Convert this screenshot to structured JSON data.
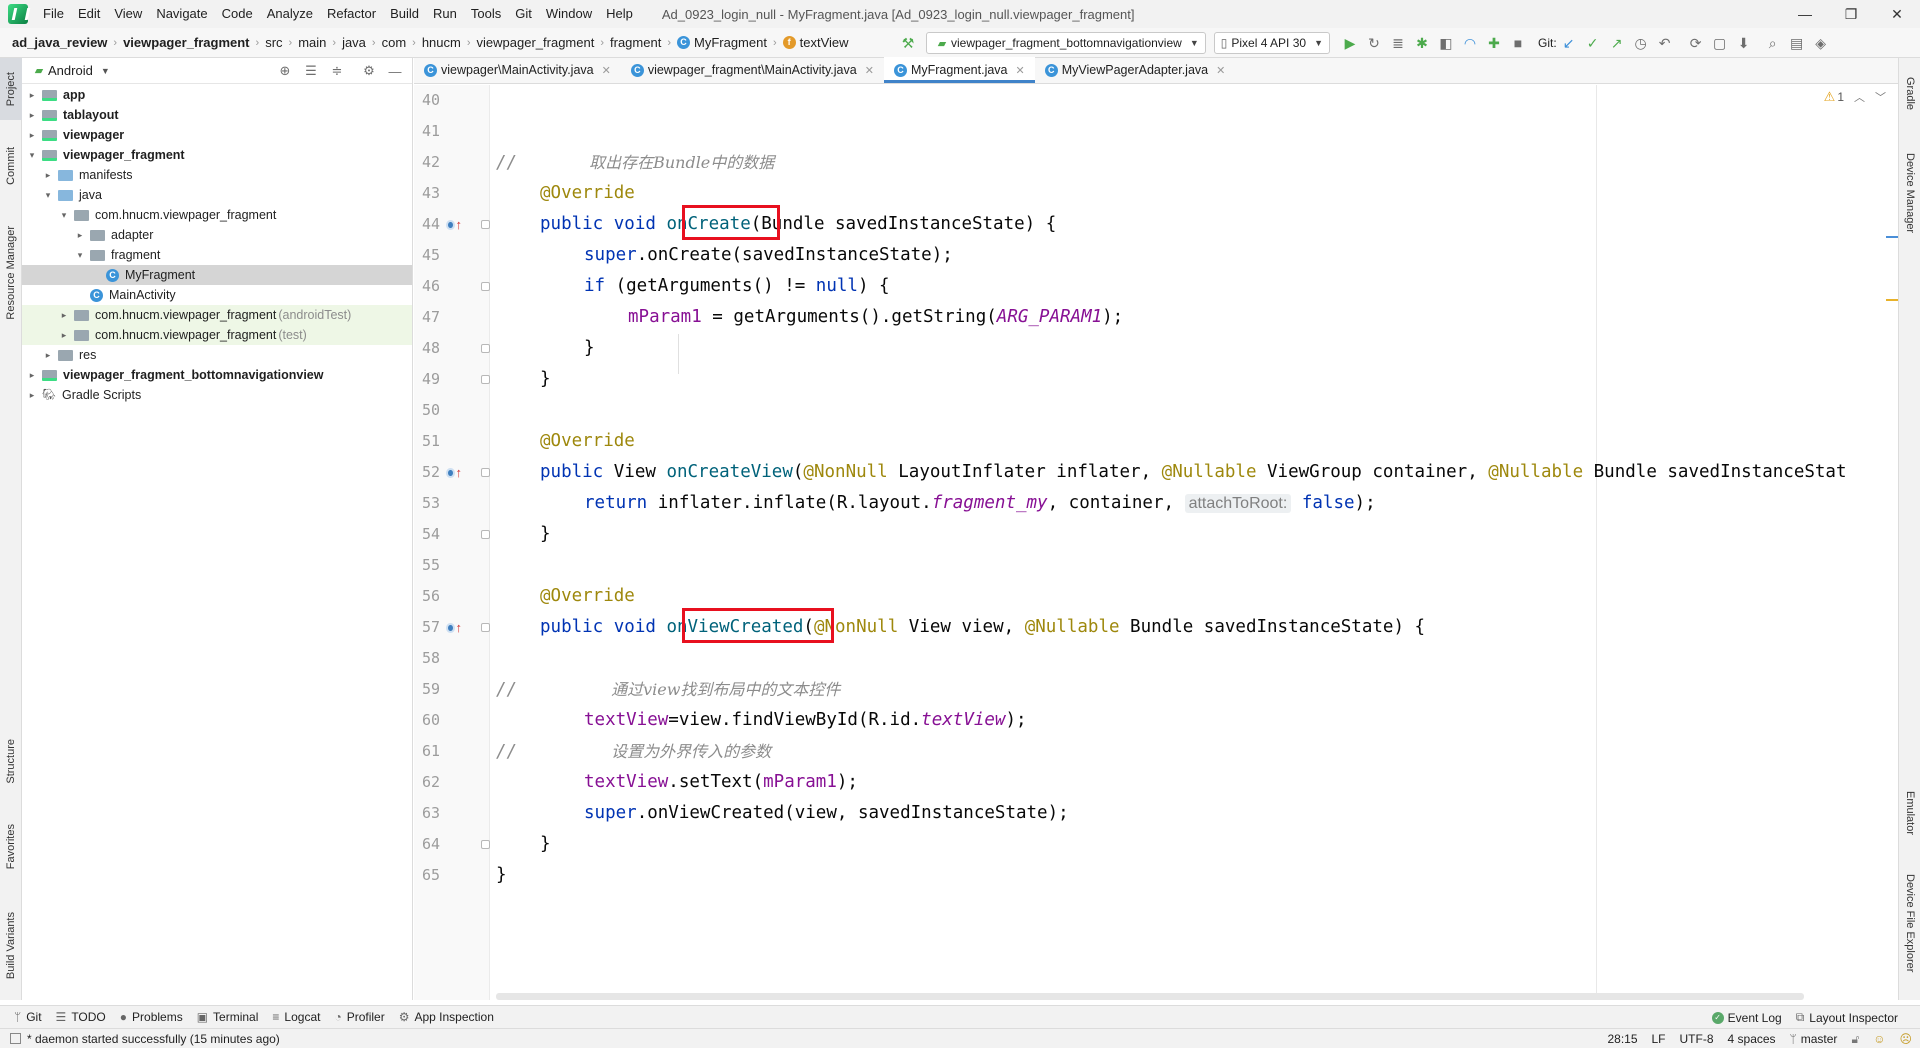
{
  "menubar": {
    "items": [
      "File",
      "Edit",
      "View",
      "Navigate",
      "Code",
      "Analyze",
      "Refactor",
      "Build",
      "Run",
      "Tools",
      "Git",
      "Window",
      "Help"
    ],
    "window_title": "Ad_0923_login_null - MyFragment.java [Ad_0923_login_null.viewpager_fragment]"
  },
  "navbar": {
    "crumbs": [
      "ad_java_review",
      "viewpager_fragment",
      "src",
      "main",
      "java",
      "com",
      "hnucm",
      "viewpager_fragment",
      "fragment",
      "MyFragment",
      "textView"
    ],
    "run_config": "viewpager_fragment_bottomnavigationview",
    "device": "Pixel 4 API 30",
    "git_label": "Git:"
  },
  "left_stripe": {
    "tabs": [
      "Project",
      "Commit",
      "Resource Manager",
      "Structure",
      "Favorites",
      "Build Variants"
    ]
  },
  "right_stripe": {
    "tabs": [
      "Gradle",
      "Device Manager",
      "Emulator",
      "Device File Explorer"
    ]
  },
  "project_panel": {
    "view_mode": "Android",
    "tree": [
      {
        "label": "app",
        "bold": true,
        "arrow": "›",
        "folder": "module"
      },
      {
        "label": "tablayout",
        "bold": true,
        "arrow": "›",
        "folder": "module"
      },
      {
        "label": "viewpager",
        "bold": true,
        "arrow": "›",
        "folder": "module"
      },
      {
        "label": "viewpager_fragment",
        "bold": true,
        "arrow": "⌄",
        "folder": "module"
      },
      {
        "label": "manifests",
        "bold": false,
        "arrow": "›",
        "folder": "blue"
      },
      {
        "label": "java",
        "bold": false,
        "arrow": "⌄",
        "folder": "blue"
      },
      {
        "label": "com.hnucm.viewpager_fragment",
        "bold": false,
        "arrow": "⌄",
        "folder": "plain"
      },
      {
        "label": "adapter",
        "bold": false,
        "arrow": "›",
        "folder": "plain"
      },
      {
        "label": "fragment",
        "bold": false,
        "arrow": "⌄",
        "folder": "plain"
      },
      {
        "label": "MyFragment",
        "bold": false,
        "arrow": "",
        "folder": "class",
        "selected": true
      },
      {
        "label": "MainActivity",
        "bold": false,
        "arrow": "",
        "folder": "class"
      },
      {
        "label": "com.hnucm.viewpager_fragment",
        "suffix": "(androidTest)",
        "bold": false,
        "arrow": "›",
        "folder": "plain",
        "test": true
      },
      {
        "label": "com.hnucm.viewpager_fragment",
        "suffix": "(test)",
        "bold": false,
        "arrow": "›",
        "folder": "plain",
        "test": true
      },
      {
        "label": "res",
        "bold": false,
        "arrow": "›",
        "folder": "plain"
      },
      {
        "label": "viewpager_fragment_bottomnavigationview",
        "bold": true,
        "arrow": "›",
        "folder": "module"
      },
      {
        "label": "Gradle Scripts",
        "bold": false,
        "arrow": "›",
        "folder": "gradle"
      }
    ]
  },
  "editor_tabs": [
    {
      "label": "viewpager\\MainActivity.java",
      "active": false
    },
    {
      "label": "viewpager_fragment\\MainActivity.java",
      "active": false
    },
    {
      "label": "MyFragment.java",
      "active": true
    },
    {
      "label": "MyViewPagerAdapter.java",
      "active": false
    }
  ],
  "editor": {
    "inspection_count": "1",
    "line_numbers": [
      "40",
      "41",
      "42",
      "43",
      "44",
      "45",
      "46",
      "47",
      "48",
      "49",
      "50",
      "51",
      "52",
      "53",
      "54",
      "55",
      "56",
      "57",
      "58",
      "59",
      "60",
      "61",
      "62",
      "63",
      "64",
      "65"
    ],
    "code": {
      "l42_slash": "//",
      "l42_comment": "取出存在Bundle中的数据",
      "override": "@Override",
      "l44_public_void": "public void ",
      "l44_method": "onCreate",
      "l44_params": "(Bundle savedInstanceState) {",
      "l45_super": "super",
      "l45_rest": ".onCreate(savedInstanceState);",
      "l46_if": "if",
      "l46_a": " (getArguments() != ",
      "l46_null": "null",
      "l46_b": ") {",
      "l47_field": "mParam1",
      "l47_a": " = getArguments().getString(",
      "l47_const": "ARG_PARAM1",
      "l47_b": ");",
      "close_brace": "}",
      "l52_public": "public",
      "l52_a": " View ",
      "l52_method": "onCreateView",
      "l52_b": "(",
      "nonnull": "@NonNull",
      "l52_c": " LayoutInflater inflater, ",
      "nullable": "@Nullable",
      "l52_d": " ViewGroup container, ",
      "l52_e": " Bundle savedInstanceStat",
      "l53_return": "return",
      "l53_a": " inflater.inflate(R.layout.",
      "l53_static": "fragment_my",
      "l53_b": ", container, ",
      "l53_hint": "attachToRoot:",
      "l53_false": "false",
      "l53_c": ");",
      "l57_public_void": "public void ",
      "l57_method": "onViewCreated",
      "l57_a": "(",
      "l57_b": " View view, ",
      "l57_c": " Bundle savedInstanceState) {",
      "l59_slash": "//",
      "l59_comment": "通过view找到布局中的文本控件",
      "l60_field": "textView",
      "l60_a": "=view.findViewById(R.id.",
      "l60_static": "textView",
      "l60_b": ");",
      "l61_slash": "//",
      "l61_comment": "设置为外界传入的参数",
      "l62_field": "textView",
      "l62_a": ".setText(",
      "l62_field2": "mParam1",
      "l62_b": ");",
      "l63_super": "super",
      "l63_rest": ".onViewCreated(view, savedInstanceState);"
    }
  },
  "tool_windows": {
    "left": [
      {
        "icon": "git-icon",
        "glyph": "ᛘ",
        "label": "Git"
      },
      {
        "icon": "todo-icon",
        "glyph": "☰",
        "label": "TODO"
      },
      {
        "icon": "problems-icon",
        "glyph": "●",
        "label": "Problems"
      },
      {
        "icon": "terminal-icon",
        "glyph": "▣",
        "label": "Terminal"
      },
      {
        "icon": "logcat-icon",
        "glyph": "≡",
        "label": "Logcat"
      },
      {
        "icon": "profiler-icon",
        "glyph": "◔",
        "label": "Profiler"
      },
      {
        "icon": "app-inspection-icon",
        "glyph": "⚙",
        "label": "App Inspection"
      }
    ],
    "right": [
      {
        "icon": "event-log-icon",
        "label": "Event Log"
      },
      {
        "icon": "layout-inspector-icon",
        "label": "Layout Inspector"
      }
    ]
  },
  "status_bar": {
    "message": "* daemon started successfully (15 minutes ago)",
    "position": "28:15",
    "line_sep": "LF",
    "encoding": "UTF-8",
    "indent": "4 spaces",
    "branch": "master"
  }
}
